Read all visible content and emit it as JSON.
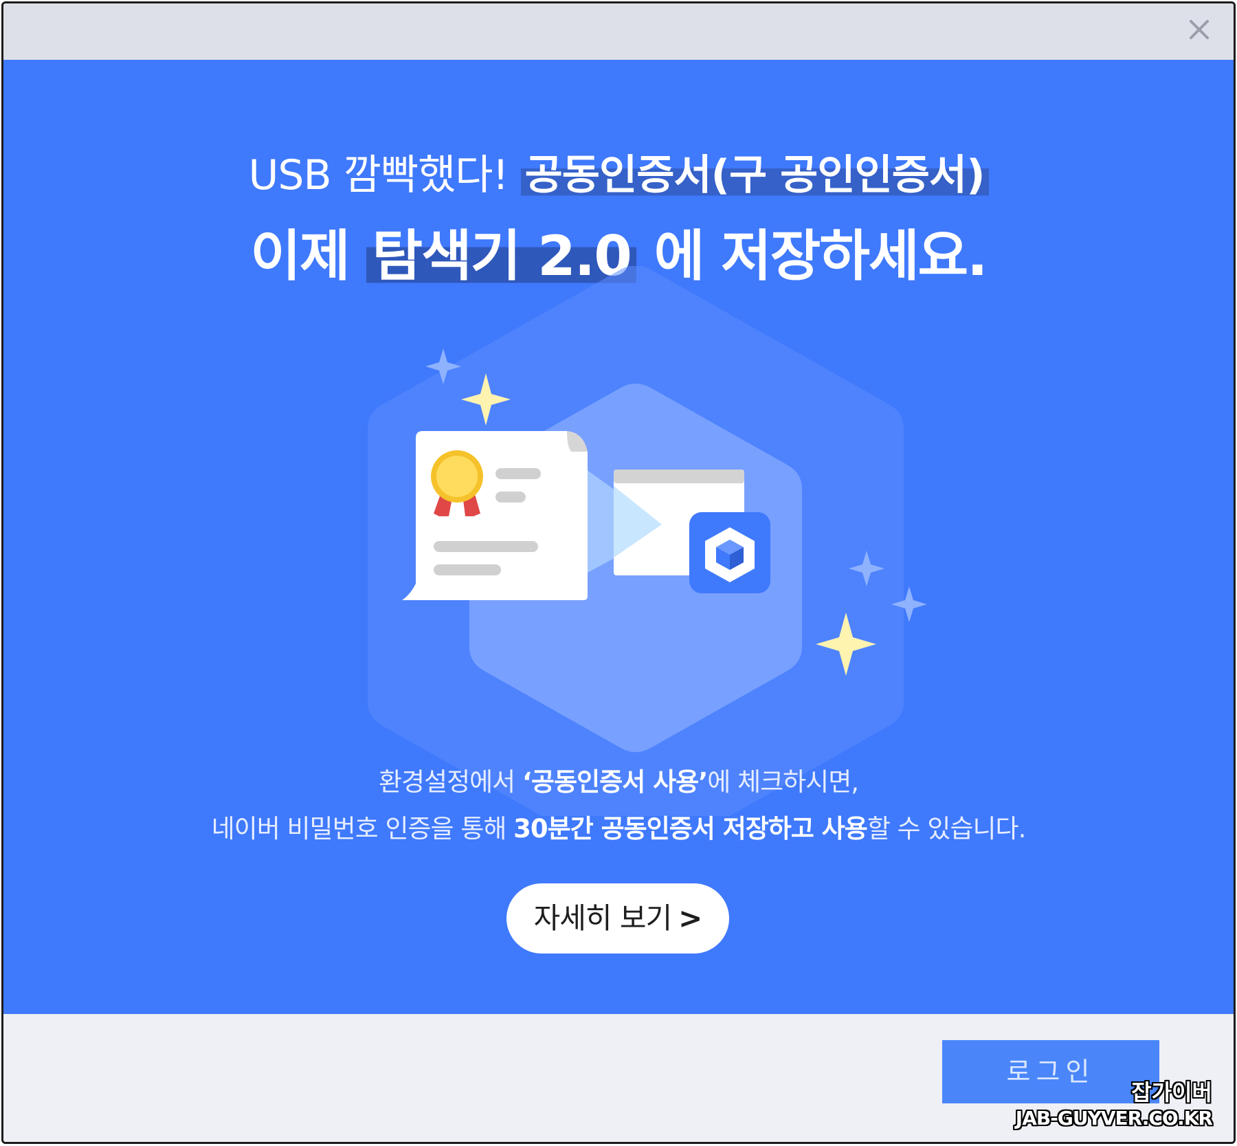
{
  "window": {
    "close_glyph": "✕"
  },
  "banner": {
    "headline_1_plain": "USB 깜빡했다! ",
    "headline_1_strong": "공동인증서(구 공인인증서)",
    "headline_2_pre": "이제 ",
    "headline_2_highlight": "탐색기 2.0",
    "headline_2_post": " 에 저장하세요.",
    "desc_1_pre": "환경설정에서 ",
    "desc_1_bold": "‘공동인증서 사용’",
    "desc_1_post": "에 체크하시면,",
    "desc_2_pre": "네이버 비밀번호 인증을 통해 ",
    "desc_2_bold": "30분간 공동인증서 저장하고 사용",
    "desc_2_post": "할 수 있습니다.",
    "detail_button_label": "자세히 보기",
    "detail_button_chevron": ">"
  },
  "footer": {
    "login_label": "로그인"
  },
  "watermark": {
    "line_1": "잡가이버",
    "line_2": "JAB-GUYVER.CO.KR"
  },
  "colors": {
    "banner_blue": "#3f79fc",
    "headline_highlight": "#2f58bb",
    "login_button": "#4a86fa",
    "star_yellow": "#fff3b0",
    "medal_gold": "#f5c22b",
    "ribbon_red": "#e04848"
  },
  "icons": [
    "close-icon",
    "certificate-icon",
    "medal-icon",
    "browser-window-icon",
    "cube-icon",
    "sparkle-icon",
    "chevron-right-icon"
  ]
}
